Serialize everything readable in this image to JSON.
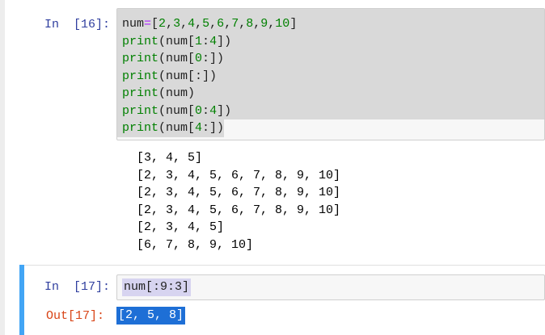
{
  "cells": [
    {
      "in_prompt": "In  [16]:",
      "code_lines": [
        "num=[2,3,4,5,6,7,8,9,10]",
        "print(num[1:4])",
        "print(num[0:])",
        "print(num[:])",
        "print(num)",
        "print(num[0:4])",
        "print(num[4:])"
      ],
      "output_lines": [
        "[3, 4, 5]",
        "[2, 3, 4, 5, 6, 7, 8, 9, 10]",
        "[2, 3, 4, 5, 6, 7, 8, 9, 10]",
        "[2, 3, 4, 5, 6, 7, 8, 9, 10]",
        "[2, 3, 4, 5]",
        "[6, 7, 8, 9, 10]"
      ]
    },
    {
      "in_prompt": "In  [17]:",
      "code": "num[:9:3]",
      "out_prompt": "Out[17]:",
      "output": "[2, 5, 8]"
    }
  ],
  "colors": {
    "in_prompt": "#303f9f",
    "out_prompt": "#d84315",
    "selected_cell_bar": "#42a5f5",
    "output_highlight": "#1e6fd6"
  }
}
